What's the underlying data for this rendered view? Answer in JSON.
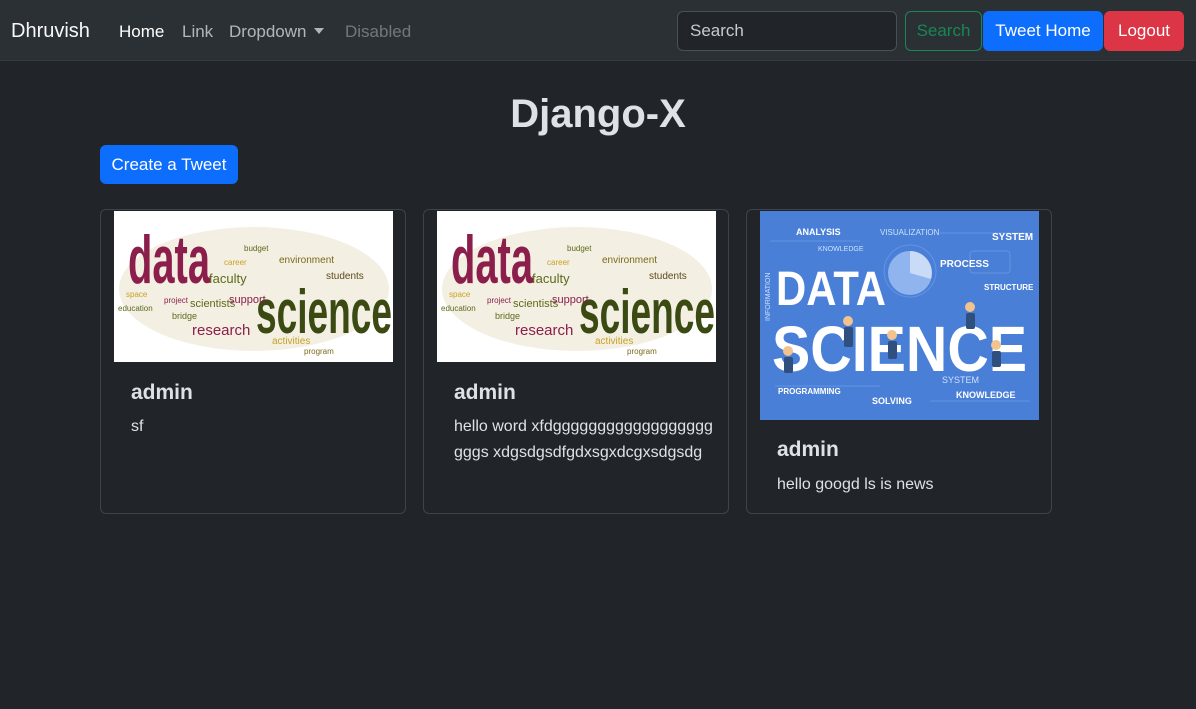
{
  "navbar": {
    "brand": "Dhruvish",
    "links": [
      {
        "label": "Home"
      },
      {
        "label": "Link"
      },
      {
        "label": "Dropdown"
      },
      {
        "label": "Disabled"
      }
    ],
    "search_placeholder": "Search",
    "search_button": "Search",
    "tweet_home_button": "Tweet Home",
    "logout_button": "Logout"
  },
  "page": {
    "title": "Django-X",
    "create_button": "Create a Tweet"
  },
  "tweets": [
    {
      "user": "admin",
      "text": "sf",
      "image": "data science word cloud"
    },
    {
      "user": "admin",
      "text": "hello word xfdgggggggggggggggggggggs xdgsdgsdfgdxsgxdcgxsdgsdg",
      "image": "data science word cloud"
    },
    {
      "user": "admin",
      "text": "hello googd ls is news",
      "image": "data science infographic"
    }
  ],
  "wordcloud": {
    "big1": "data",
    "big2": "science",
    "words": [
      "environment",
      "faculty",
      "research",
      "scientists",
      "students",
      "support",
      "activities",
      "bridge",
      "program",
      "space",
      "education",
      "project",
      "budget",
      "career"
    ]
  },
  "infographic": {
    "big1": "DATA",
    "big2": "SCIENCE",
    "labels": [
      "ANALYSIS",
      "VISUALIZATION",
      "SYSTEM",
      "KNOWLEDGE",
      "PROCESS",
      "STRUCTURE",
      "PROGRAMMING",
      "SOLVING",
      "KNOWLEDGE",
      "SYSTEM",
      "INFORMATION"
    ]
  },
  "colors": {
    "background": "#212529",
    "navbar": "#2b3035",
    "primary": "#0d6efd",
    "success": "#198754",
    "danger": "#dc3545"
  }
}
